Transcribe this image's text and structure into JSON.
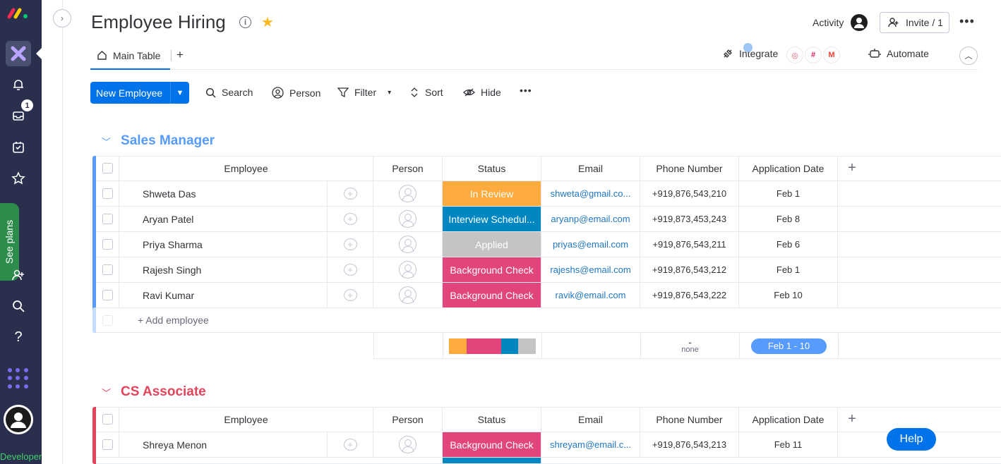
{
  "rail": {
    "notifications_count": "1",
    "see_plans": "See plans",
    "developer": "Developer"
  },
  "header": {
    "title": "Employee Hiring",
    "activity": "Activity",
    "invite": "Invite / 1"
  },
  "tabs": {
    "main_table": "Main Table",
    "add": "+",
    "integrate": "Integrate",
    "automate": "Automate"
  },
  "toolbar": {
    "new_item": "New Employee",
    "search": "Search",
    "person": "Person",
    "filter": "Filter",
    "sort": "Sort",
    "hide": "Hide"
  },
  "columns": [
    "Employee",
    "Person",
    "Status",
    "Email",
    "Phone Number",
    "Application Date"
  ],
  "colors": {
    "accent": "#0073ea",
    "group1": "#579bfc",
    "group2": "#e2445c",
    "in_review": "#fdab3d",
    "interview": "#0086c0",
    "applied": "#c4c4c4",
    "background_check": "#e2447c"
  },
  "groups": [
    {
      "name": "Sales Manager",
      "color": "#579bfc",
      "rows": [
        {
          "employee": "Shweta Das",
          "status": "In Review",
          "status_color": "#fdab3d",
          "email": "shweta@gmail.co...",
          "phone": "+919,876,543,210",
          "date": "Feb 1"
        },
        {
          "employee": "Aryan Patel",
          "status": "Interview Schedul...",
          "status_color": "#0086c0",
          "email": "aryanp@email.com",
          "phone": "+919,873,453,243",
          "date": "Feb 8"
        },
        {
          "employee": "Priya Sharma",
          "status": "Applied",
          "status_color": "#c4c4c4",
          "email": "priyas@email.com",
          "phone": "+919,876,543,211",
          "date": "Feb 6"
        },
        {
          "employee": "Rajesh Singh",
          "status": "Background Check",
          "status_color": "#e2447c",
          "email": "rajeshs@email.com",
          "phone": "+919,876,543,212",
          "date": "Feb 1"
        },
        {
          "employee": "Ravi Kumar",
          "status": "Background Check",
          "status_color": "#e2447c",
          "email": "ravik@email.com",
          "phone": "+919,876,543,222",
          "date": "Feb 10"
        }
      ],
      "add_label": "+ Add employee",
      "summary": {
        "status_bar": [
          {
            "color": "#fdab3d",
            "fraction": 0.2
          },
          {
            "color": "#e2447c",
            "fraction": 0.4
          },
          {
            "color": "#0086c0",
            "fraction": 0.2
          },
          {
            "color": "#c4c4c4",
            "fraction": 0.2
          }
        ],
        "phone_dash": "-",
        "phone_none": "none",
        "date_range": "Feb 1 - 10"
      }
    },
    {
      "name": "CS Associate",
      "color": "#e2445c",
      "rows": [
        {
          "employee": "Shreya Menon",
          "status": "Background Check",
          "status_color": "#e2447c",
          "email": "shreyam@email.c...",
          "phone": "+919,876,543,213",
          "date": "Feb 11"
        }
      ]
    }
  ],
  "help": "Help"
}
